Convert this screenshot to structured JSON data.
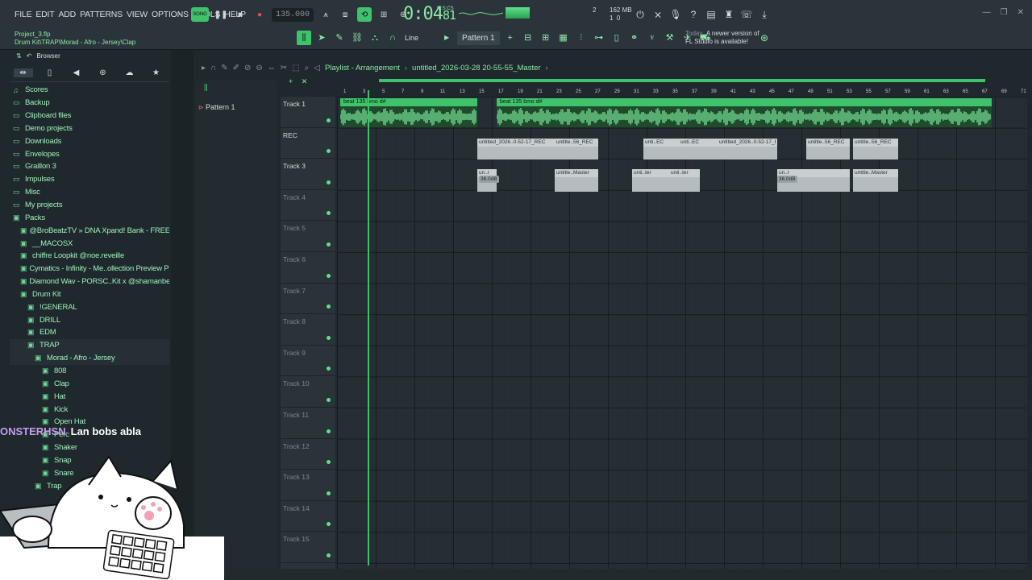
{
  "menu": [
    "FILE",
    "EDIT",
    "ADD",
    "PATTERNS",
    "VIEW",
    "OPTIONS",
    "TOOLS",
    "HELP"
  ],
  "project": {
    "file": "Project_3.flp",
    "path": "Drum Kit\\TRAP\\Morad - Afro - Jersey\\Clap"
  },
  "transport": {
    "mode": "SONG",
    "tempo": "135.000"
  },
  "timer": {
    "main": "0:04",
    "frac": "81",
    "unit": "M:S:CS"
  },
  "stats": {
    "steps": "2",
    "memory": "162 MB",
    "cpu": "1",
    "zero": "0"
  },
  "toolbar": {
    "snap": "Line",
    "pattern": "Pattern 1"
  },
  "news": {
    "today": "Today",
    "line1": "A newer version of",
    "line2": "FL Studio is available!"
  },
  "browser": {
    "title": "Browser",
    "tree": [
      {
        "label": "Scores",
        "indent": 0,
        "icon": "music-note-icon"
      },
      {
        "label": "Backup",
        "indent": 0,
        "icon": "folder-icon"
      },
      {
        "label": "Clipboard files",
        "indent": 0,
        "icon": "folder-icon"
      },
      {
        "label": "Demo projects",
        "indent": 0,
        "icon": "folder-icon"
      },
      {
        "label": "Downloads",
        "indent": 0,
        "icon": "folder-icon"
      },
      {
        "label": "Envelopes",
        "indent": 0,
        "icon": "folder-icon"
      },
      {
        "label": "Graillon 3",
        "indent": 0,
        "icon": "folder-icon"
      },
      {
        "label": "Impulses",
        "indent": 0,
        "icon": "folder-icon"
      },
      {
        "label": "Misc",
        "indent": 0,
        "icon": "folder-icon"
      },
      {
        "label": "My projects",
        "indent": 0,
        "icon": "folder-icon"
      },
      {
        "label": "Packs",
        "indent": 0,
        "icon": "pack-icon"
      },
      {
        "label": "@BroBeatzTV  » DNA Xpand! Bank - FREE Ver",
        "indent": 1,
        "icon": "pack-icon"
      },
      {
        "label": "__MACOSX",
        "indent": 1,
        "icon": "pack-icon"
      },
      {
        "label": "chiffre Loopkit @noe.reveille",
        "indent": 1,
        "icon": "pack-icon"
      },
      {
        "label": "Cymatics - Infinity - Me..ollection Preview Pack",
        "indent": 1,
        "icon": "pack-icon"
      },
      {
        "label": "Diamond Wav - PORSC..Kit x @shamanbeatz68",
        "indent": 1,
        "icon": "pack-icon"
      },
      {
        "label": "Drum Kit",
        "indent": 1,
        "icon": "pack-icon"
      },
      {
        "label": "!GENERAL",
        "indent": 2,
        "icon": "pack-icon"
      },
      {
        "label": "DRILL",
        "indent": 2,
        "icon": "pack-icon"
      },
      {
        "label": "EDM",
        "indent": 2,
        "icon": "pack-icon"
      },
      {
        "label": "TRAP",
        "indent": 2,
        "icon": "pack-icon"
      },
      {
        "label": "Morad - Afro - Jersey",
        "indent": 3,
        "icon": "pack-icon"
      },
      {
        "label": "808",
        "indent": 4,
        "icon": "pack-icon"
      },
      {
        "label": "Clap",
        "indent": 4,
        "icon": "pack-icon"
      },
      {
        "label": "Hat",
        "indent": 4,
        "icon": "pack-icon"
      },
      {
        "label": "Kick",
        "indent": 4,
        "icon": "pack-icon"
      },
      {
        "label": "Open Hat",
        "indent": 4,
        "icon": "pack-icon"
      },
      {
        "label": "Perc",
        "indent": 4,
        "icon": "pack-icon"
      },
      {
        "label": "Shaker",
        "indent": 4,
        "icon": "pack-icon"
      },
      {
        "label": "Snap",
        "indent": 4,
        "icon": "pack-icon"
      },
      {
        "label": "Snare",
        "indent": 4,
        "icon": "pack-icon"
      },
      {
        "label": "Trap",
        "indent": 3,
        "icon": "pack-icon"
      }
    ]
  },
  "playlist": {
    "title": "Playlist - Arrangement",
    "project": "untitled_2026-03-28 20-55-55_Master",
    "patterns": [
      "Pattern 1"
    ],
    "ruler": [
      "1",
      "3",
      "5",
      "7",
      "9",
      "11",
      "13",
      "15",
      "17",
      "19",
      "21",
      "23",
      "25",
      "27",
      "29",
      "31",
      "33",
      "35",
      "37",
      "39",
      "41",
      "43",
      "45",
      "47",
      "49",
      "51",
      "53",
      "55",
      "57",
      "59",
      "61",
      "63",
      "65",
      "67",
      "69",
      "71"
    ],
    "tracks": [
      "Track 1",
      "REC",
      "Track 3",
      "Track 4",
      "Track 5",
      "Track 6",
      "Track 7",
      "Track 8",
      "Track 9",
      "Track 10",
      "Track 11",
      "Track 12",
      "Track 13",
      "Track 14",
      "Track 15"
    ],
    "audio_clips": [
      "beat 135 bmo d#",
      "beat 135 bmo d#"
    ],
    "rec_clips": [
      "untitled_2026..0-52-17_REC",
      "untitle..56_REC",
      "unti..EC",
      "unti..EC",
      "untitled_2026..0-52-17_REC",
      "untitle..56_REC",
      "untitle..56_REC"
    ],
    "master_clips": [
      "un..r",
      "untitle..Master",
      "unti..ter",
      "unti..ter",
      "un..r",
      "untitle..Master",
      "untitle..Master"
    ],
    "gain_badge": "36.0dB"
  },
  "chat": {
    "user": "ONSTERHSN",
    "message": "Lan bobs abla"
  },
  "colors": {
    "accent": "#3fc36a",
    "bg": "#1f282d",
    "clip": "#b5bcbf"
  }
}
